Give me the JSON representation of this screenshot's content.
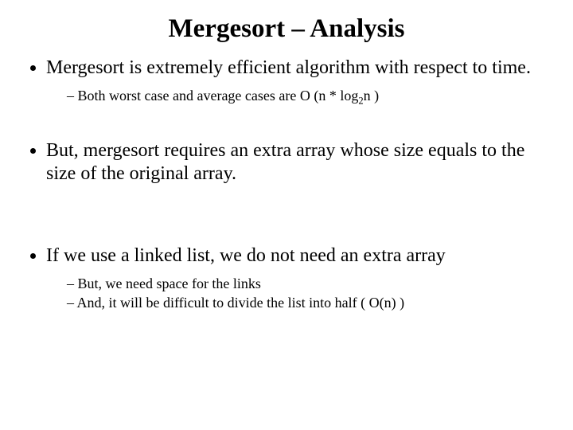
{
  "title": "Mergesort – Analysis",
  "b1": "Mergesort is extremely efficient algorithm with respect to time.",
  "b1s1_a": "Both worst case and average cases are O (n * log",
  "b1s1_sub": "2",
  "b1s1_b": "n )",
  "b2": "But, mergesort requires an extra array whose size equals to the size of the original array.",
  "b3": "If we use a linked list, we do not need an extra array",
  "b3s1": "But, we need space for the links",
  "b3s2": "And, it will be difficult to divide the list into half ( O(n) )"
}
